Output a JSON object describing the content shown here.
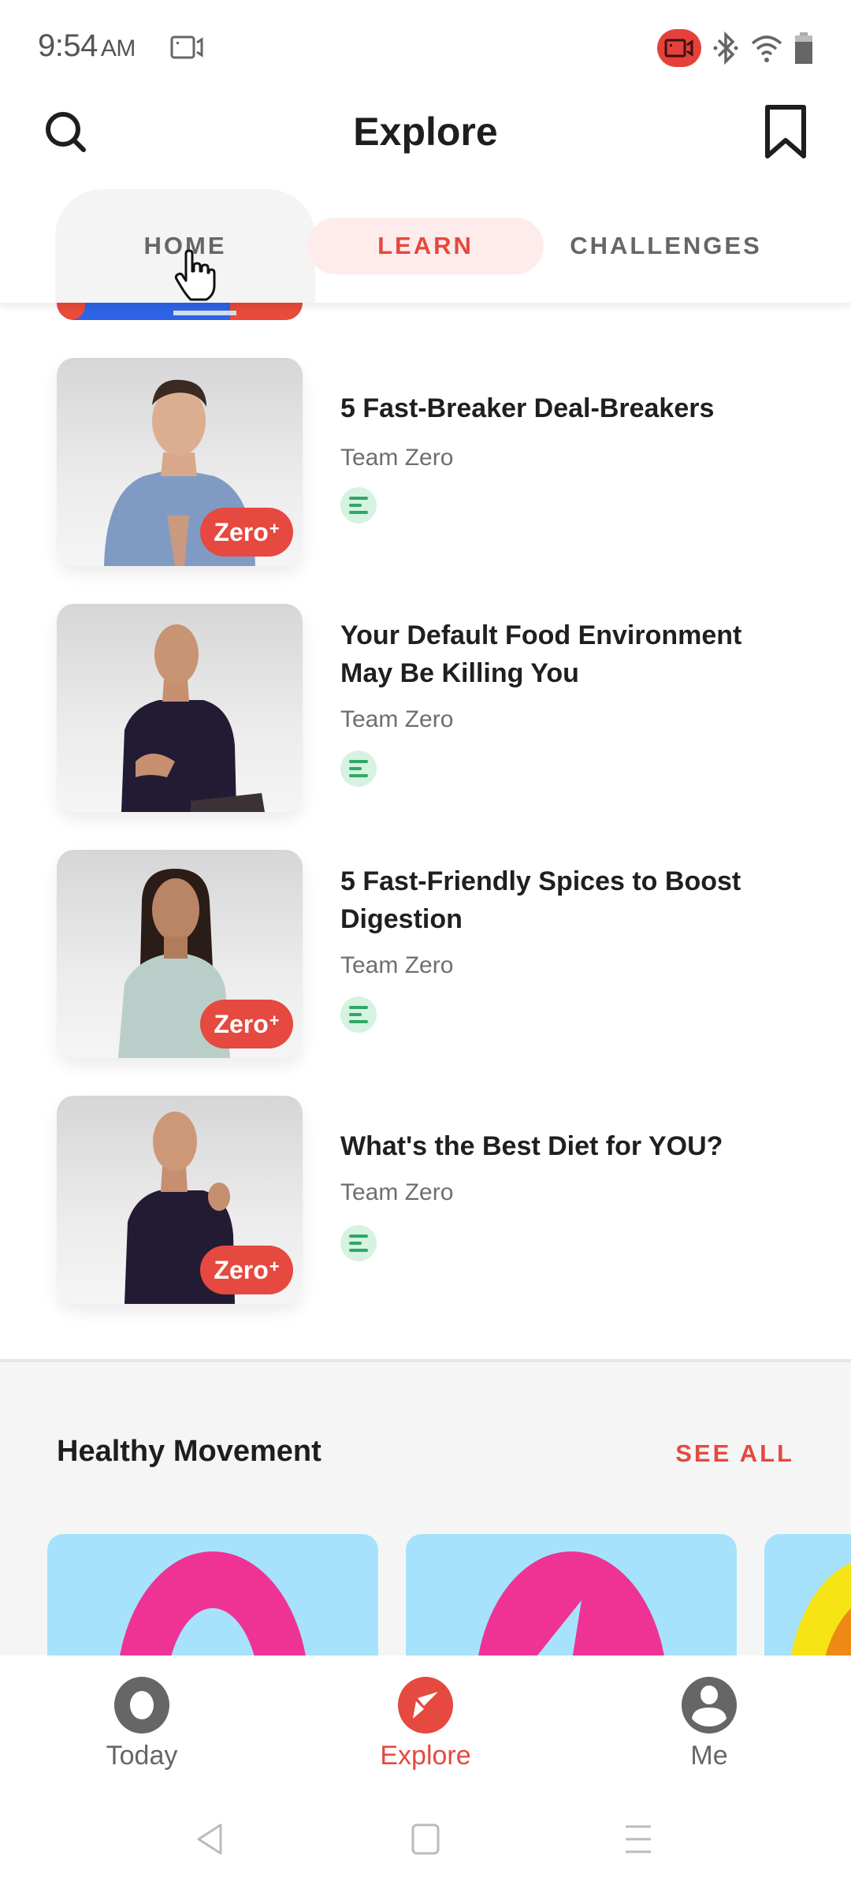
{
  "status_bar": {
    "time": "9:54",
    "ampm": "AM",
    "icons": [
      "screen-record-icon",
      "bluetooth-icon",
      "wifi-icon",
      "battery-icon"
    ],
    "record_color": "#e5413a"
  },
  "header": {
    "title": "Explore",
    "left_icon": "search-icon",
    "right_icon": "bookmark-icon"
  },
  "tabs": [
    {
      "label": "HOME",
      "state": "pressed"
    },
    {
      "label": "LEARN",
      "state": "selected"
    },
    {
      "label": "CHALLENGES",
      "state": "default"
    }
  ],
  "articles": [
    {
      "title": "5 Fast-Breaker Deal-Breakers",
      "author": "Team Zero",
      "badge": "Zero",
      "badge_sup": "+",
      "type_icon": "article-text-icon"
    },
    {
      "title": "Your Default Food Environment May Be Killing You",
      "author": "Team Zero",
      "badge": null,
      "type_icon": "article-text-icon"
    },
    {
      "title": "5 Fast-Friendly Spices to Boost Digestion",
      "author": "Team Zero",
      "badge": "Zero",
      "badge_sup": "+",
      "type_icon": "article-text-icon"
    },
    {
      "title": "What's the Best Diet for YOU?",
      "author": "Team Zero",
      "badge": "Zero",
      "badge_sup": "+",
      "type_icon": "article-text-icon"
    }
  ],
  "section": {
    "title": "Healthy Movement",
    "see_all": "SEE ALL"
  },
  "bottom_nav": [
    {
      "label": "Today",
      "icon": "today-ring-icon",
      "active": false
    },
    {
      "label": "Explore",
      "icon": "compass-icon",
      "active": true
    },
    {
      "label": "Me",
      "icon": "profile-icon",
      "active": false
    }
  ],
  "colors": {
    "accent": "#e5493f",
    "learn_tab_bg": "#fdeceb",
    "article_type_bg": "#d6f2e1",
    "article_type_fg": "#2fa866",
    "movement_card_bg": "#a6e2fb",
    "movement_pink": "#ee3394",
    "nav_inactive": "#666666"
  }
}
